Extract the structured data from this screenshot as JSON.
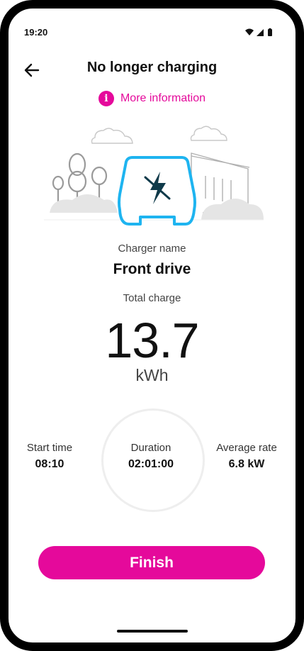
{
  "status_bar": {
    "time": "19:20"
  },
  "header": {
    "title": "No longer charging"
  },
  "info_link": {
    "icon": "i",
    "label": "More information"
  },
  "colors": {
    "accent": "#e5099b",
    "illustration_car": "#1eb4f0",
    "illustration_bolt": "#0f3a4a"
  },
  "charger": {
    "name_label": "Charger name",
    "name": "Front drive"
  },
  "total": {
    "label": "Total charge",
    "value": "13.7",
    "unit": "kWh"
  },
  "stats": {
    "start": {
      "label": "Start time",
      "value": "08:10"
    },
    "duration": {
      "label": "Duration",
      "value": "02:01:00"
    },
    "rate": {
      "label": "Average rate",
      "value": "6.8 kW"
    }
  },
  "actions": {
    "finish_label": "Finish"
  }
}
